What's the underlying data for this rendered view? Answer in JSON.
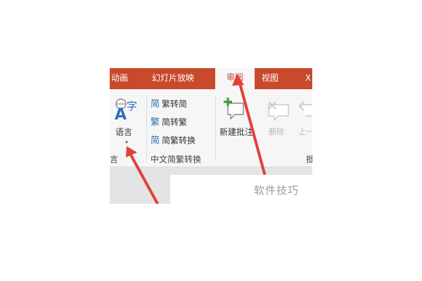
{
  "tabs": {
    "animations": "动画",
    "slideshow": "幻灯片放映",
    "review": "审阅",
    "view": "视图",
    "extra": "X"
  },
  "language": {
    "icon_glyph_top": "字",
    "icon_glyph_letter": "A",
    "label": "语言",
    "caret": "▾"
  },
  "convert": {
    "to_simplified": "繁转简",
    "to_traditional": "简转繁",
    "convert": "简繁转换",
    "glyph_1": "简",
    "glyph_2": "繁",
    "glyph_3": "简",
    "group_label": "中文简繁转换"
  },
  "comments": {
    "new_comment": "新建批注",
    "delete": "删除",
    "previous": "上一"
  },
  "group_labels": {
    "language_partial": "言",
    "comments_partial": "批"
  },
  "watermark": "软件技巧",
  "colors": {
    "tab_bar": "#c8492b",
    "arrow": "#e0413b",
    "accent_blue": "#2c6fb7",
    "comment_plus": "#3a9a3a"
  }
}
